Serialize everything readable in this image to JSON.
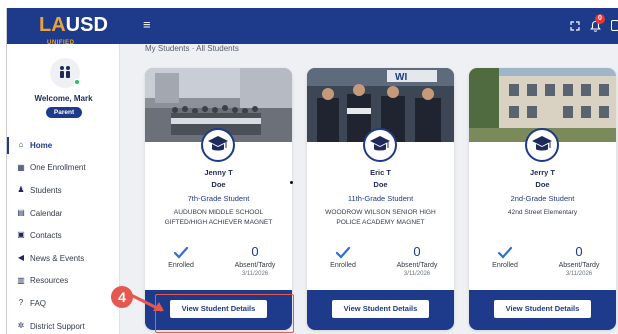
{
  "header": {
    "logo_la": "LA",
    "logo_usd": "USD",
    "logo_unified": "UNIFIED",
    "menu_glyph": "≡",
    "notification_count": "0"
  },
  "sidebar": {
    "welcome": "Welcome, Mark",
    "role": "Parent",
    "items": [
      {
        "label": "Home",
        "icon": "home-icon",
        "glyph": "⌂",
        "active": true
      },
      {
        "label": "One Enrollment",
        "icon": "enrollment-icon",
        "glyph": "▦"
      },
      {
        "label": "Students",
        "icon": "students-icon",
        "glyph": "♟"
      },
      {
        "label": "Calendar",
        "icon": "calendar-icon",
        "glyph": "▤"
      },
      {
        "label": "Contacts",
        "icon": "contacts-icon",
        "glyph": "▣"
      },
      {
        "label": "News & Events",
        "icon": "megaphone-icon",
        "glyph": "◀"
      },
      {
        "label": "Resources",
        "icon": "resources-icon",
        "glyph": "▥"
      },
      {
        "label": "FAQ",
        "icon": "faq-icon",
        "glyph": "?"
      },
      {
        "label": "District Support",
        "icon": "support-icon",
        "glyph": "✲"
      }
    ]
  },
  "main": {
    "breadcrumb": "My Students · All Students"
  },
  "students": [
    {
      "first": "Jenny T",
      "last": "Doe",
      "grade": "7th-Grade Student",
      "school_line1": "AUDUBON MIDDLE SCHOOL",
      "school_line2": "GIFTED/HIGH ACHIEVER MAGNET",
      "enrolled_label": "Enrolled",
      "absent_count": "0",
      "absent_label": "Absent/Tardy",
      "absent_date": "3/11/2026",
      "button": "View Student Details"
    },
    {
      "first": "Eric T",
      "last": "Doe",
      "grade": "11th-Grade Student",
      "school_line1": "WOODROW WILSON SENIOR HIGH",
      "school_line2": "POLICE ACADEMY MAGNET",
      "enrolled_label": "Enrolled",
      "absent_count": "0",
      "absent_label": "Absent/Tardy",
      "absent_date": "3/11/2026",
      "button": "View Student Details"
    },
    {
      "first": "Jerry T",
      "last": "Doe",
      "grade": "2nd-Grade Student",
      "school_line1": "42nd Street Elementary",
      "school_line2": "",
      "enrolled_label": "Enrolled",
      "absent_count": "0",
      "absent_label": "Absent/Tardy",
      "absent_date": "3/11/2026",
      "button": "View Student Details"
    }
  ],
  "annotation": {
    "step": "4",
    "color": "#e5574f"
  },
  "colors": {
    "primary": "#1e3a8a",
    "accent": "#e8a33d",
    "background": "#eef0f4"
  }
}
